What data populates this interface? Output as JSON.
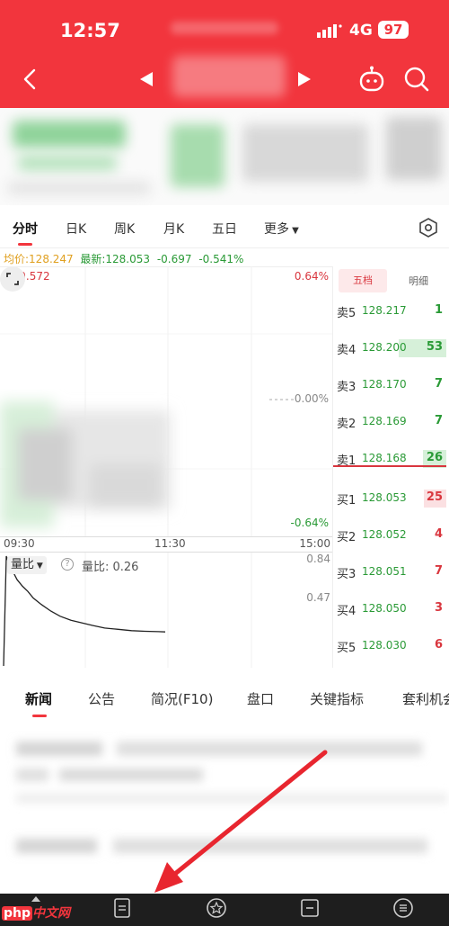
{
  "status": {
    "time": "12:57",
    "network": "4G",
    "battery": "97"
  },
  "tabs": [
    "分时",
    "日K",
    "周K",
    "月K",
    "五日",
    "更多"
  ],
  "quote": {
    "avg_label": "均价:",
    "avg_value": "128.247",
    "last_label": "最新:",
    "last_value": "128.053",
    "change": "-0.697",
    "change_pct": "-0.541%"
  },
  "chart_data": {
    "type": "line",
    "title": "",
    "price_high": "129.572",
    "pct_high": "0.64%",
    "pct_zero": "0.00%",
    "pct_low": "-0.64%",
    "x_ticks": [
      "09:30",
      "11:30",
      "15:00"
    ],
    "volume": {
      "label": "量比",
      "value_text": "量比: 0.26",
      "ymax": "0.84",
      "ymid": "0.47",
      "x": [
        0,
        2,
        4,
        6,
        8,
        10,
        14,
        18,
        22,
        28,
        35,
        42,
        50,
        58,
        66,
        75,
        85,
        95,
        105,
        115,
        120
      ],
      "values": [
        0.0,
        0.84,
        0.78,
        0.74,
        0.7,
        0.66,
        0.61,
        0.57,
        0.52,
        0.47,
        0.42,
        0.38,
        0.35,
        0.33,
        0.31,
        0.29,
        0.28,
        0.27,
        0.265,
        0.262,
        0.26
      ]
    }
  },
  "order_book": {
    "tabs": [
      "五档",
      "明细"
    ],
    "asks": [
      {
        "label": "卖5",
        "price": "128.217",
        "volume": "1"
      },
      {
        "label": "卖4",
        "price": "128.200",
        "volume": "53"
      },
      {
        "label": "卖3",
        "price": "128.170",
        "volume": "7"
      },
      {
        "label": "卖2",
        "price": "128.169",
        "volume": "7"
      },
      {
        "label": "卖1",
        "price": "128.168",
        "volume": "26"
      }
    ],
    "bids": [
      {
        "label": "买1",
        "price": "128.053",
        "volume": "25"
      },
      {
        "label": "买2",
        "price": "128.052",
        "volume": "4"
      },
      {
        "label": "买3",
        "price": "128.051",
        "volume": "7"
      },
      {
        "label": "买4",
        "price": "128.050",
        "volume": "3"
      },
      {
        "label": "买5",
        "price": "128.030",
        "volume": "6"
      }
    ]
  },
  "news_tabs": [
    "新闻",
    "公告",
    "简况(F10)",
    "盘口",
    "关键指标",
    "套利机会"
  ],
  "watermark": {
    "brand": "php",
    "suffix": "中文网"
  },
  "colors": {
    "brand_red": "#f2353d",
    "up_red": "#d9363e",
    "down_green": "#2a9a36",
    "avg_yellow": "#e0a020"
  }
}
